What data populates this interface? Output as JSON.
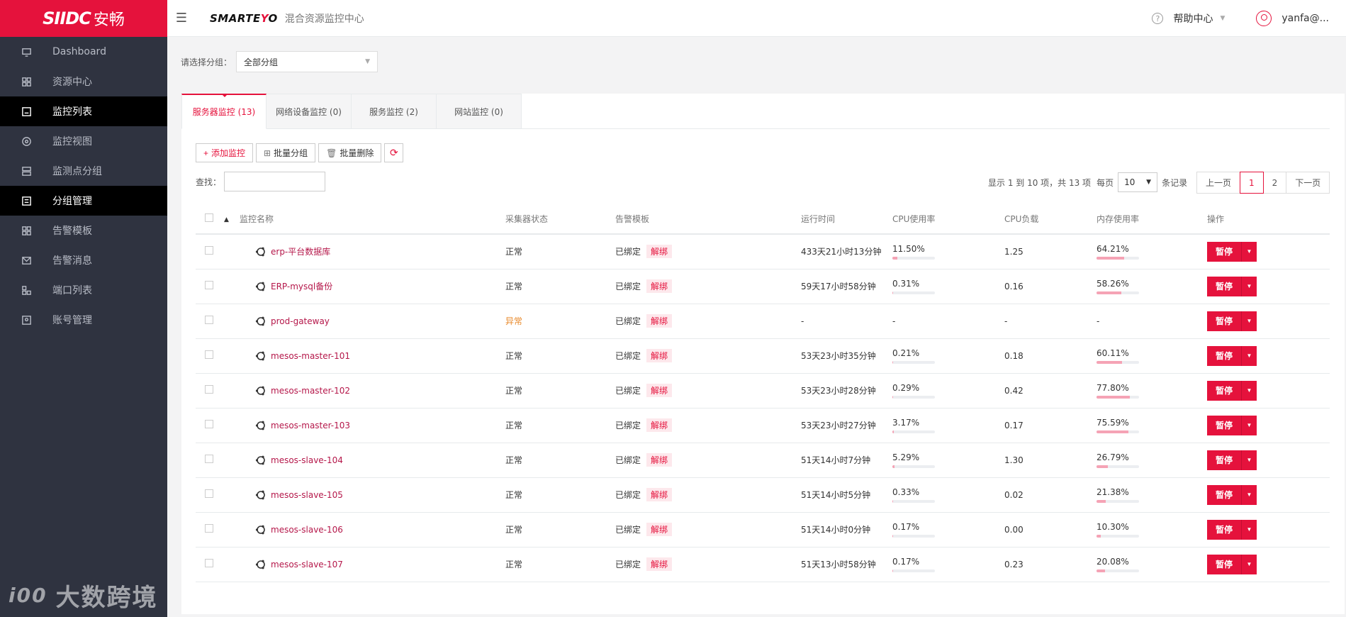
{
  "sidebar": {
    "logo_mark": "SIIDC",
    "logo_text": "安畅",
    "items": [
      {
        "label": "Dashboard",
        "icon": "monitor-icon",
        "active": false
      },
      {
        "label": "资源中心",
        "icon": "grid-icon",
        "active": false
      },
      {
        "label": "监控列表",
        "icon": "list-icon",
        "active": true
      },
      {
        "label": "监控视图",
        "icon": "target-icon",
        "active": false
      },
      {
        "label": "监测点分组",
        "icon": "server-icon",
        "active": false
      },
      {
        "label": "分组管理",
        "icon": "panel-icon",
        "active": true
      },
      {
        "label": "告警模板",
        "icon": "template-icon",
        "active": false
      },
      {
        "label": "告警消息",
        "icon": "mail-icon",
        "active": false
      },
      {
        "label": "端口列表",
        "icon": "port-icon",
        "active": false
      },
      {
        "label": "账号管理",
        "icon": "account-icon",
        "active": false
      }
    ]
  },
  "watermark": {
    "logo": "i00",
    "text": "大数跨境"
  },
  "header": {
    "brand_prefix": "SMARTE",
    "brand_e": "Y",
    "brand_suffix": "O",
    "brand_sub": "混合资源监控中心",
    "help_label": "帮助中心",
    "user_label": "yanfa@..."
  },
  "group": {
    "label": "请选择分组：",
    "value": "全部分组"
  },
  "tabs": [
    {
      "label": "服务器监控 (13)",
      "active": true
    },
    {
      "label": "网络设备监控 (0)",
      "active": false
    },
    {
      "label": "服务监控 (2)",
      "active": false
    },
    {
      "label": "网站监控 (0)",
      "active": false
    }
  ],
  "toolbar": {
    "add_label": "添加监控",
    "group_label": "批量分组",
    "delete_label": "批量删除"
  },
  "search": {
    "label": "查找：",
    "placeholder": ""
  },
  "pagination": {
    "info": "显示 1 到 10 项，共 13 项",
    "per_page_label": "每页",
    "per_page_value": "10",
    "per_page_suffix": "条记录",
    "prev": "上一页",
    "pages": [
      "1",
      "2"
    ],
    "next": "下一页"
  },
  "table": {
    "headers": {
      "name": "监控名称",
      "collector": "采集器状态",
      "template": "告警模板",
      "uptime": "运行时间",
      "cpu_usage": "CPU使用率",
      "cpu_load": "CPU负载",
      "mem_usage": "内存使用率",
      "actions": "操作"
    },
    "bound_label": "已绑定",
    "unbind_label": "解绑",
    "action_label": "暂停",
    "rows": [
      {
        "name": "erp-平台数据库",
        "status": "正常",
        "uptime": "433天21小时13分钟",
        "cpu": "11.50%",
        "cpu_pct": 11.5,
        "load": "1.25",
        "mem": "64.21%",
        "mem_pct": 64.21
      },
      {
        "name": "ERP-mysql备份",
        "status": "正常",
        "uptime": "59天17小时58分钟",
        "cpu": "0.31%",
        "cpu_pct": 0.31,
        "load": "0.16",
        "mem": "58.26%",
        "mem_pct": 58.26
      },
      {
        "name": "prod-gateway",
        "status": "异常",
        "uptime": "-",
        "cpu": "-",
        "cpu_pct": null,
        "load": "-",
        "mem": "-",
        "mem_pct": null
      },
      {
        "name": "mesos-master-101",
        "status": "正常",
        "uptime": "53天23小时35分钟",
        "cpu": "0.21%",
        "cpu_pct": 0.21,
        "load": "0.18",
        "mem": "60.11%",
        "mem_pct": 60.11
      },
      {
        "name": "mesos-master-102",
        "status": "正常",
        "uptime": "53天23小时28分钟",
        "cpu": "0.29%",
        "cpu_pct": 0.29,
        "load": "0.42",
        "mem": "77.80%",
        "mem_pct": 77.8
      },
      {
        "name": "mesos-master-103",
        "status": "正常",
        "uptime": "53天23小时27分钟",
        "cpu": "3.17%",
        "cpu_pct": 3.17,
        "load": "0.17",
        "mem": "75.59%",
        "mem_pct": 75.59
      },
      {
        "name": "mesos-slave-104",
        "status": "正常",
        "uptime": "51天14小时7分钟",
        "cpu": "5.29%",
        "cpu_pct": 5.29,
        "load": "1.30",
        "mem": "26.79%",
        "mem_pct": 26.79
      },
      {
        "name": "mesos-slave-105",
        "status": "正常",
        "uptime": "51天14小时5分钟",
        "cpu": "0.33%",
        "cpu_pct": 0.33,
        "load": "0.02",
        "mem": "21.38%",
        "mem_pct": 21.38
      },
      {
        "name": "mesos-slave-106",
        "status": "正常",
        "uptime": "51天14小时0分钟",
        "cpu": "0.17%",
        "cpu_pct": 0.17,
        "load": "0.00",
        "mem": "10.30%",
        "mem_pct": 10.3
      },
      {
        "name": "mesos-slave-107",
        "status": "正常",
        "uptime": "51天13小时58分钟",
        "cpu": "0.17%",
        "cpu_pct": 0.17,
        "load": "0.23",
        "mem": "20.08%",
        "mem_pct": 20.08
      }
    ]
  },
  "colors": {
    "accent": "#e5123c",
    "sidebar": "#2f3340",
    "warning": "#e8892b"
  }
}
